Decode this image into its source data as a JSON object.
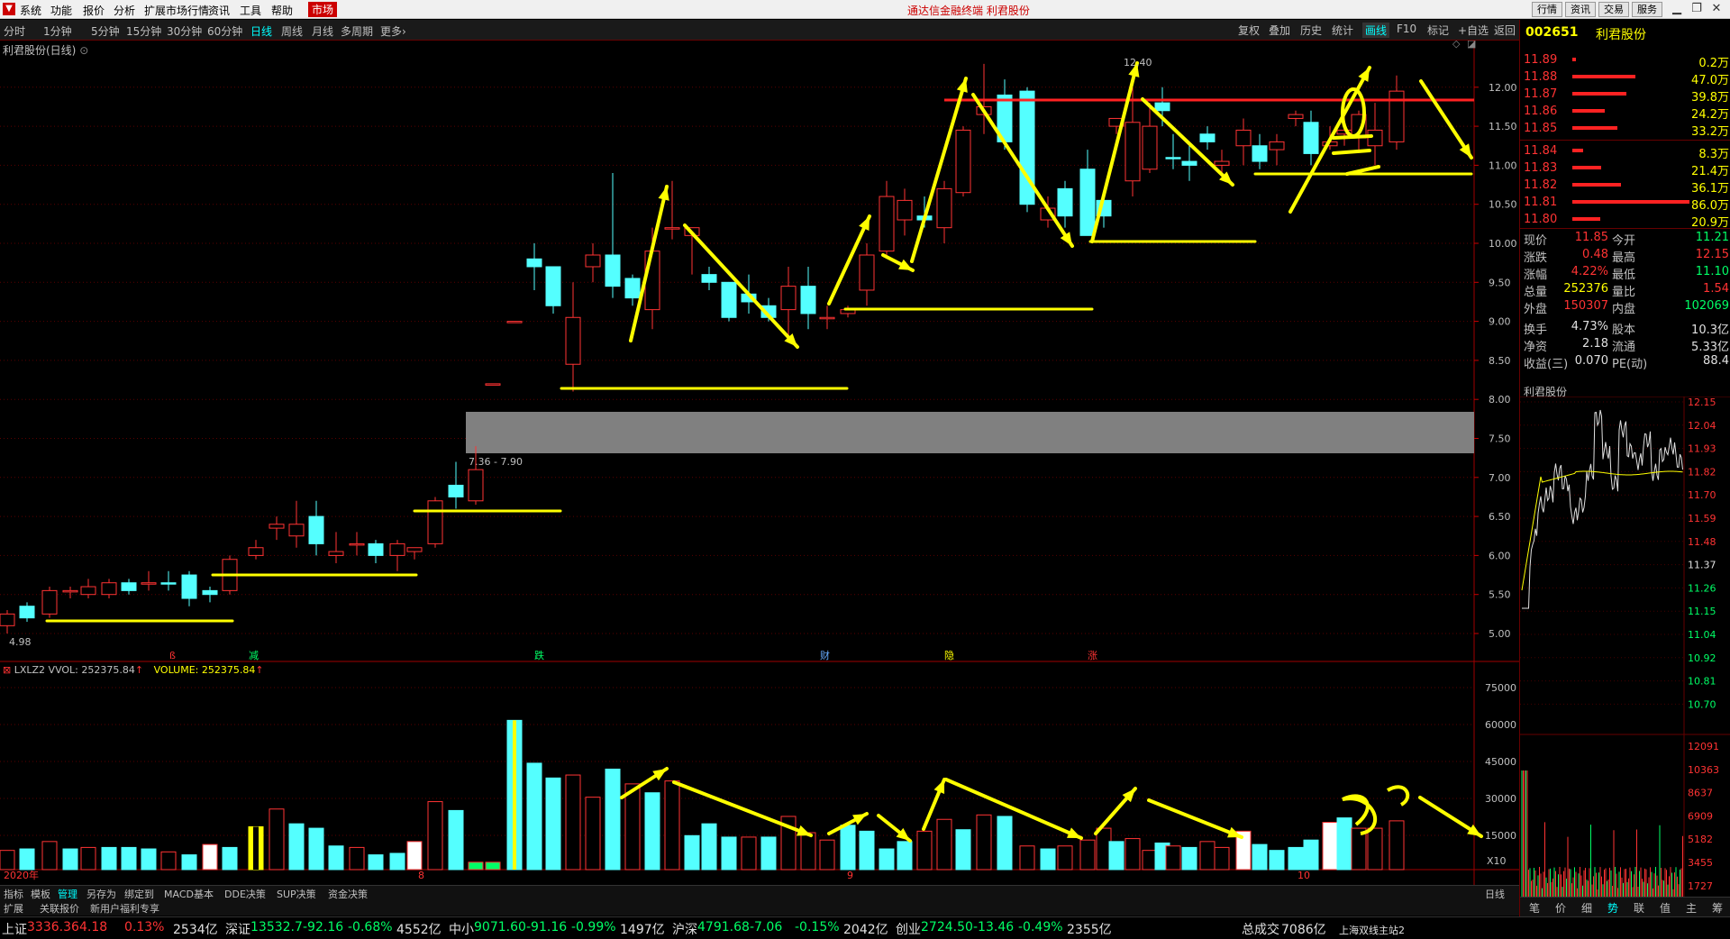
{
  "menu": {
    "items": [
      "系统",
      "功能",
      "报价",
      "分析",
      "扩展市场行情",
      "资讯",
      "工具",
      "帮助"
    ],
    "highlight": "市场",
    "title": "通达信金融终端  利君股份",
    "buttons": [
      "行情",
      "资讯",
      "交易",
      "服务"
    ]
  },
  "periods": {
    "items": [
      "分时",
      "1分钟",
      "5分钟",
      "15分钟",
      "30分钟",
      "60分钟",
      "日线",
      "周线",
      "月线",
      "多周期",
      "更多"
    ],
    "active": "日线"
  },
  "toolbar": {
    "items": [
      "复权",
      "叠加",
      "历史",
      "统计",
      "画线",
      "F10",
      "标记",
      "+自选",
      "返回"
    ],
    "active": "画线"
  },
  "chart": {
    "title": "利君股份(日线)",
    "price_labels": [
      "12.00",
      "11.50",
      "11.00",
      "10.50",
      "10.00",
      "9.50",
      "9.00",
      "8.50",
      "8.00",
      "7.50",
      "7.00",
      "6.50",
      "6.00",
      "5.50",
      "5.00"
    ],
    "zone_label": "7.36 - 7.90",
    "high_label": "12.40",
    "low_label": "4.98",
    "date_labels": {
      "year": "2020年",
      "m1": "8",
      "m2": "9",
      "m3": "10"
    },
    "event_marks": [
      "减",
      "跌",
      "财",
      "隐",
      "涨"
    ],
    "zone_color": "#808080",
    "up_color": "#ff3333",
    "down_color": "#54ffff"
  },
  "volume": {
    "header": "LXLZ2 VVOL: 252375.84",
    "header2": "VOLUME: 252375.84",
    "labels": [
      "75000",
      "60000",
      "45000",
      "30000",
      "15000"
    ],
    "unit": "X10"
  },
  "bottom_tabs": [
    "指标",
    "模板",
    "管理",
    "另存为",
    "绑定到",
    "MACD基本",
    "DDE决策",
    "SUP决策",
    "资金决策"
  ],
  "bottom_tabs_active": "管理",
  "bottom_tabs2": [
    "扩展",
    "关联报价",
    "新用户福利专享"
  ],
  "period_side": "日线",
  "status": [
    {
      "name": "上证",
      "price": "3336.36",
      "chg": "4.18",
      "pct": "0.13%",
      "amt": "2534亿",
      "dir": "up"
    },
    {
      "name": "深证",
      "price": "13532.7",
      "chg": "-92.16",
      "pct": "-0.68%",
      "amt": "4552亿",
      "dir": "dn"
    },
    {
      "name": "中小",
      "price": "9071.60",
      "chg": "-91.16",
      "pct": "-0.99%",
      "amt": "1497亿",
      "dir": "dn"
    },
    {
      "name": "沪深",
      "price": "4791.68",
      "chg": "-7.06",
      "pct": "-0.15%",
      "amt": "2042亿",
      "dir": "dn"
    },
    {
      "name": "创业",
      "price": "2724.50",
      "chg": "-13.46",
      "pct": "-0.49%",
      "amt": "2355亿",
      "dir": "dn"
    }
  ],
  "status_total_label": "总成交",
  "status_total": "7086亿",
  "status_server": "上海双线主站2",
  "quote": {
    "code": "002651",
    "name": "利君股份",
    "sell": [
      {
        "p": "11.89",
        "v": "0.2万",
        "w": 4
      },
      {
        "p": "11.88",
        "v": "47.0万",
        "w": 70
      },
      {
        "p": "11.87",
        "v": "39.8万",
        "w": 60
      },
      {
        "p": "11.86",
        "v": "24.2万",
        "w": 36
      },
      {
        "p": "11.85",
        "v": "33.2万",
        "w": 50
      }
    ],
    "buy": [
      {
        "p": "11.84",
        "v": "8.3万",
        "w": 12
      },
      {
        "p": "11.83",
        "v": "21.4万",
        "w": 32
      },
      {
        "p": "11.82",
        "v": "36.1万",
        "w": 54
      },
      {
        "p": "11.81",
        "v": "86.0万",
        "w": 130
      },
      {
        "p": "11.80",
        "v": "20.9万",
        "w": 31
      }
    ],
    "rows": [
      {
        "l1": "现价",
        "v1": "11.85",
        "c1": "up",
        "l2": "今开",
        "v2": "11.21",
        "c2": "dn"
      },
      {
        "l1": "涨跌",
        "v1": "0.48",
        "c1": "up",
        "l2": "最高",
        "v2": "12.15",
        "c2": "up"
      },
      {
        "l1": "涨幅",
        "v1": "4.22%",
        "c1": "up",
        "l2": "最低",
        "v2": "11.10",
        "c2": "dn"
      },
      {
        "l1": "总量",
        "v1": "252376",
        "c1": "ye",
        "l2": "量比",
        "v2": "1.54",
        "c2": "up"
      },
      {
        "l1": "外盘",
        "v1": "150307",
        "c1": "up",
        "l2": "内盘",
        "v2": "102069",
        "c2": "dn"
      },
      {
        "l1": "换手",
        "v1": "4.73%",
        "c1": "wh",
        "l2": "股本",
        "v2": "10.3亿",
        "c2": "wh"
      },
      {
        "l1": "净资",
        "v1": "2.18",
        "c1": "wh",
        "l2": "流通",
        "v2": "5.33亿",
        "c2": "wh"
      },
      {
        "l1": "收益(三)",
        "v1": "0.070",
        "c1": "wh",
        "l2": "PE(动)",
        "v2": "88.4",
        "c2": "wh"
      }
    ],
    "mini_title": "利君股份",
    "mini_price": [
      "12.15",
      "12.04",
      "11.93",
      "11.82",
      "11.70",
      "11.59",
      "11.48",
      "11.37",
      "11.26",
      "11.15",
      "11.04",
      "10.92",
      "10.81",
      "10.70"
    ],
    "mini_vol": [
      "12091",
      "10363",
      "8637",
      "6909",
      "5182",
      "3455",
      "1727"
    ],
    "tabs": [
      "笔",
      "价",
      "细",
      "势",
      "联",
      "值",
      "主",
      "筹"
    ],
    "tab_active": "势"
  }
}
